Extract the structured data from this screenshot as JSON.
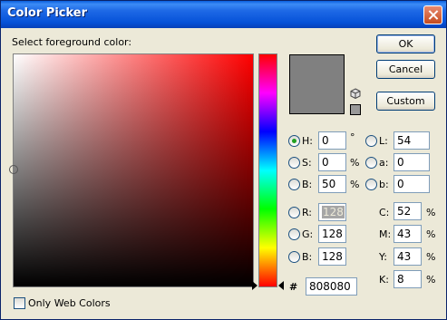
{
  "window": {
    "title": "Color Picker"
  },
  "labels": {
    "select_prompt": "Select foreground color:"
  },
  "buttons": {
    "ok": "OK",
    "cancel": "Cancel",
    "custom": "Custom"
  },
  "hsb": [
    {
      "label": "H:",
      "value": "0",
      "unit": "°",
      "selected": true
    },
    {
      "label": "S:",
      "value": "0",
      "unit": "%",
      "selected": false
    },
    {
      "label": "B:",
      "value": "50",
      "unit": "%",
      "selected": false
    }
  ],
  "rgb": [
    {
      "label": "R:",
      "value": "128",
      "selected": false
    },
    {
      "label": "G:",
      "value": "128",
      "selected": false
    },
    {
      "label": "B:",
      "value": "128",
      "selected": false
    }
  ],
  "lab": [
    {
      "label": "L:",
      "value": "54",
      "selected": false
    },
    {
      "label": "a:",
      "value": "0",
      "selected": false
    },
    {
      "label": "b:",
      "value": "0",
      "selected": false
    }
  ],
  "cmyk": [
    {
      "label": "C:",
      "value": "52",
      "unit": "%"
    },
    {
      "label": "M:",
      "value": "43",
      "unit": "%"
    },
    {
      "label": "Y:",
      "value": "43",
      "unit": "%"
    },
    {
      "label": "K:",
      "value": "8",
      "unit": "%"
    }
  ],
  "hex": {
    "prefix": "#",
    "value": "808080"
  },
  "web_colors": {
    "label": "Only Web Colors",
    "checked": false
  },
  "colors": {
    "current": "#808080",
    "gamut_swatch": "#999999"
  }
}
